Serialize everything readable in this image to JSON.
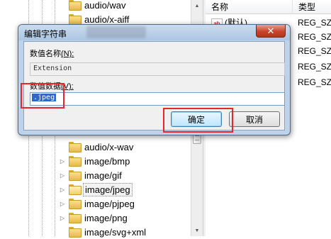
{
  "tree": {
    "items": [
      {
        "label": "audio/wav",
        "expandable": false
      },
      {
        "label": "audio/x-aiff",
        "expandable": false
      },
      {
        "label": "audio/x-wav",
        "expandable": false
      },
      {
        "label": "image/bmp",
        "expandable": true
      },
      {
        "label": "image/gif",
        "expandable": true
      },
      {
        "label": "image/jpeg",
        "expandable": true,
        "selected": true
      },
      {
        "label": "image/pjpeg",
        "expandable": true
      },
      {
        "label": "image/png",
        "expandable": true
      },
      {
        "label": "image/svg+xml",
        "expandable": false
      }
    ]
  },
  "values_pane": {
    "columns": {
      "name": "名称",
      "type": "类型"
    },
    "rows": [
      {
        "name": "(默认)",
        "type": "REG_SZ"
      },
      {
        "name": "",
        "type": "REG_SZ"
      },
      {
        "name": "",
        "type": "REG_SZ"
      },
      {
        "name": "",
        "type": "REG_SZ"
      },
      {
        "name": "",
        "type": "REG_SZ"
      }
    ]
  },
  "dialog": {
    "title": "编辑字符串",
    "close_label": "✕",
    "value_name_label": "数值名称",
    "value_name_hotkey": "(N):",
    "value_name": "Extension",
    "value_data_label": "数值数据",
    "value_data_hotkey": "(V):",
    "value_data": ".jpeg",
    "ok_label": "确定",
    "cancel_label": "取消"
  },
  "colors": {
    "highlight": "#e8262a",
    "selection": "#3166c5",
    "dialog_frame": "#bdd3ec",
    "close_button": "#c8442c"
  },
  "icons": {
    "tree_folder": "folder-icon",
    "tree_expander": "triangle-right-icon",
    "value_type": "ab-string-icon",
    "dialog_close": "close-icon"
  }
}
